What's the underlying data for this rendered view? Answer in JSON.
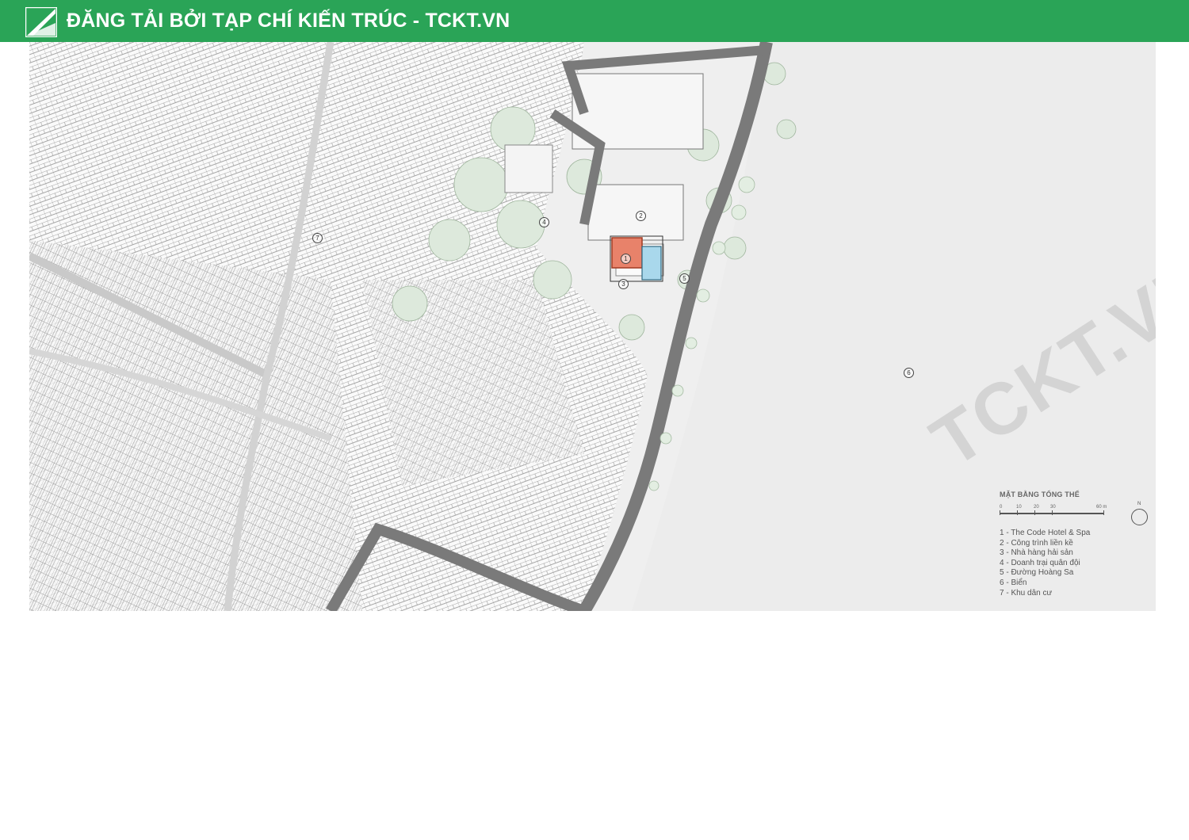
{
  "banner": {
    "title": "ĐĂNG TẢI BỞI TẠP CHÍ KIẾN TRÚC - TCKT.VN",
    "background_color": "#2aa457"
  },
  "map": {
    "markers": [
      {
        "label": "1"
      },
      {
        "label": "2"
      },
      {
        "label": "3"
      },
      {
        "label": "4"
      },
      {
        "label": "5"
      },
      {
        "label": "6"
      },
      {
        "label": "7"
      }
    ],
    "legend": {
      "title": "MẶT BẰNG TỔNG THỂ",
      "scale": {
        "ticks": [
          "0",
          "10",
          "20",
          "30",
          "60 m"
        ]
      },
      "north_label": "N",
      "items": [
        "1 - The Code Hotel & Spa",
        "2 - Công trình liền kề",
        "3 - Nhà hàng hải sản",
        "4 - Doanh trại quân đội",
        "5 - Đường Hoàng Sa",
        "6 - Biển",
        "7 - Khu dân cư"
      ]
    },
    "watermark": "TCKT.VN",
    "colors": {
      "road": "#7a7a7a",
      "site": "#e8826a",
      "pool": "#a9d8ec",
      "trees": "#cfe3cf"
    }
  }
}
